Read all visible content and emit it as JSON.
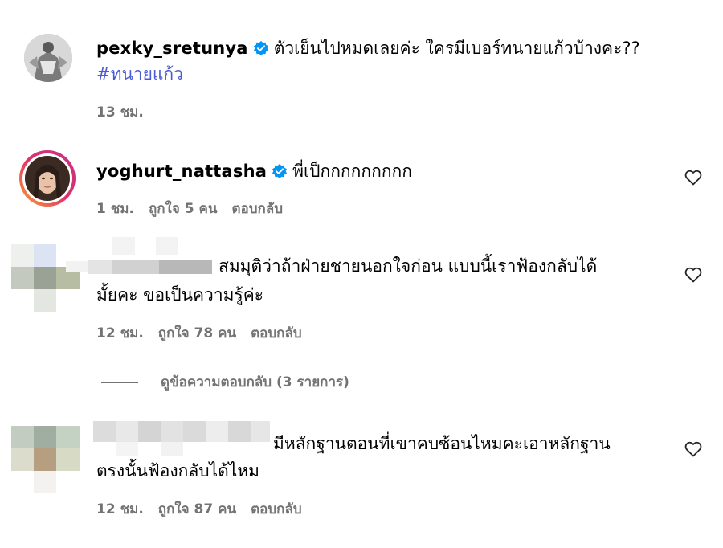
{
  "caption": {
    "username": "pexky_sretunya",
    "text": "ตัวเย็นไปหมดเลยค่ะ ใครมีเบอร์ทนายแก้วบ้างคะ??",
    "hashtag": "#ทนายแก้ว",
    "time": "13 ชม."
  },
  "comments": [
    {
      "username": "yoghurt_nattasha",
      "text": "พี่เป็กกกกกกกกก",
      "time": "1 ชม.",
      "likes": "ถูกใจ 5 คน",
      "reply": "ตอบกลับ"
    },
    {
      "username": "",
      "line1": "สมมุติว่าถ้าฝ่ายชายนอกใจก่อน แบบนี้เราฟ้องกลับได้",
      "line2": "มั้ยคะ ขอเป็นความรู้ค่ะ",
      "time": "12 ชม.",
      "likes": "ถูกใจ 78 คน",
      "reply": "ตอบกลับ"
    },
    {
      "username": "",
      "line1": "มีหลักฐานตอนที่เขาคบซ้อนไหมคะเอาหลักฐาน",
      "line2": "ตรงนั้นฟ้องกลับได้ไหม",
      "time": "12 ชม.",
      "likes": "ถูกใจ 87 คน",
      "reply": "ตอบกลับ"
    }
  ],
  "view_replies": "ดูข้อความตอบกลับ (3 รายการ)",
  "colors": {
    "meta": "#737373",
    "hashtag": "#4b5bd6",
    "verified": "#0095f6",
    "story_ring_start": "#f9a12e",
    "story_ring_end": "#c13584"
  },
  "icons": [
    "verified-badge-icon",
    "heart-icon"
  ]
}
